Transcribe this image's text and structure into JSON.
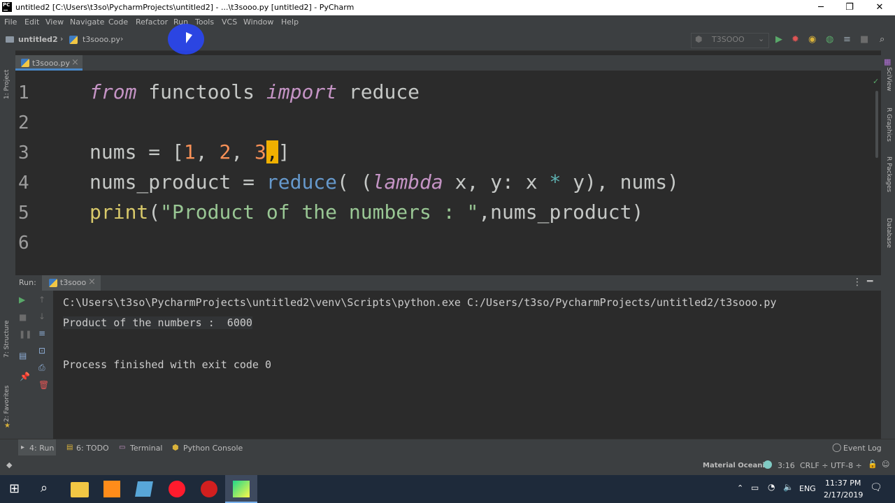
{
  "window": {
    "title": "untitled2 [C:\\Users\\t3so\\PycharmProjects\\untitled2] - ...\\t3sooo.py [untitled2] - PyCharm",
    "logo": "PC",
    "controls": {
      "minimize": "─",
      "restore": "❐",
      "close": "✕"
    }
  },
  "menu": [
    "File",
    "Edit",
    "View",
    "Navigate",
    "Code",
    "Refactor",
    "Run",
    "Tools",
    "VCS",
    "Window",
    "Help"
  ],
  "navbar": {
    "project": "untitled2",
    "file": "t3sooo.py",
    "run_config": "T3SOOO"
  },
  "editor_tab": {
    "label": "t3sooo.py",
    "close": "×"
  },
  "editor": {
    "line_numbers": [
      "1",
      "2",
      "3",
      "4",
      "5",
      "6"
    ],
    "lines": {
      "l1": {
        "kw_from": "from",
        "mod": " functools ",
        "kw_import": "import",
        "name": " reduce"
      },
      "l3": {
        "name": "nums = ",
        "open": "[",
        "n1": "1",
        "c1": ", ",
        "n2": "2",
        "c2": ", ",
        "n3": "3",
        "caret": ",",
        "close": "]"
      },
      "l4": {
        "name": "nums_product = ",
        "fn": "reduce",
        "p1": "( (",
        "kw_lambda": "lambda",
        "args": " x, y: x ",
        "op": "*",
        "rest": " y), nums)"
      },
      "l5": {
        "bi": "print",
        "p1": "(",
        "str": "\"Product of the numbers : \"",
        "rest": ",nums_product)"
      }
    }
  },
  "left_strip": {
    "project": "1: Project",
    "structure": "7: Structure",
    "favorites": "2: Favorites"
  },
  "right_strip": {
    "sciview": "SciView",
    "rgraphics": "R Graphics",
    "rpackages": "R Packages",
    "database": "Database"
  },
  "run_panel": {
    "label": "Run:",
    "tab": "t3sooo",
    "tab_close": "×",
    "console": [
      "C:\\Users\\t3so\\PycharmProjects\\untitled2\\venv\\Scripts\\python.exe C:/Users/t3so/PycharmProjects/untitled2/t3sooo.py",
      "Product of the numbers :  6000",
      "",
      "Process finished with exit code 0"
    ]
  },
  "tool_windows": {
    "run": "4: Run",
    "todo": "6: TODO",
    "terminal": "Terminal",
    "python_console": "Python Console",
    "event_log": "Event Log"
  },
  "status": {
    "theme": "Material Oceanic",
    "position": "3:16",
    "line_sep": "CRLF ÷",
    "encoding": "UTF-8 ÷"
  },
  "taskbar": {
    "lang": "ENG",
    "time": "11:37 PM",
    "date": "2/17/2019"
  }
}
